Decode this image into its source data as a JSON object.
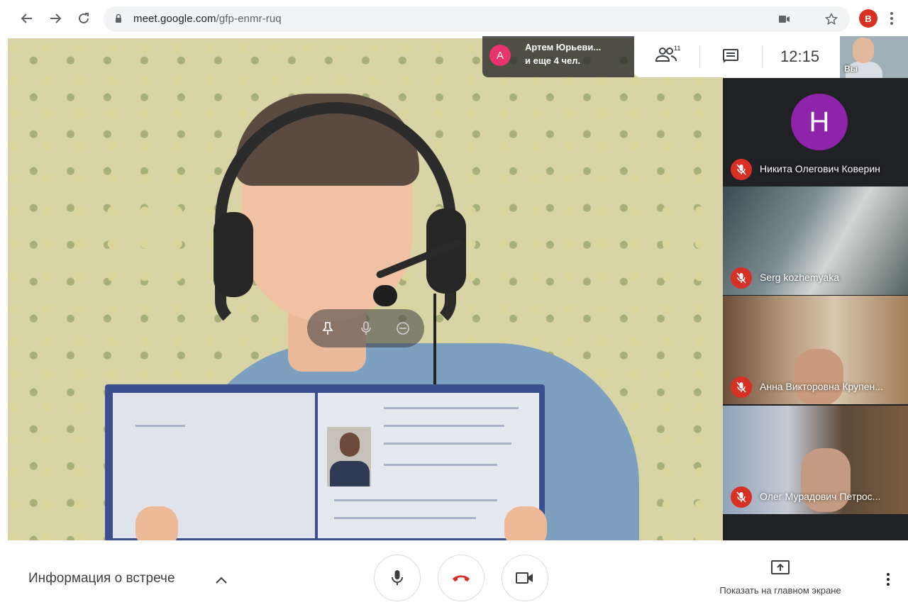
{
  "browser": {
    "url_host": "meet.google.com",
    "url_path": "/gfp-enmr-ruq",
    "profile_initial": "B"
  },
  "top_panel": {
    "presenter_initial": "А",
    "presenter_name": "Артем Юрьеви...",
    "presenter_more": "и еще 4 чел.",
    "people_count": "11",
    "time": "12:15",
    "self_label": "Вы"
  },
  "participants": [
    {
      "initial": "Н",
      "name": "Никита Олегович Коверин",
      "muted": true
    },
    {
      "name": "Serg kozhemyaka",
      "muted": true
    },
    {
      "name": "Анна Викторовна Крупен...",
      "muted": true
    },
    {
      "name": "Олег Мурадович Петрос...",
      "muted": true
    }
  ],
  "bottom_bar": {
    "meeting_info": "Информация о встрече",
    "present_label": "Показать на главном экране"
  },
  "colors": {
    "hangup": "#d93025",
    "avatar_presenter": "#e8336e",
    "avatar_participant": "#8e24aa",
    "muted_badge": "#d93025"
  }
}
